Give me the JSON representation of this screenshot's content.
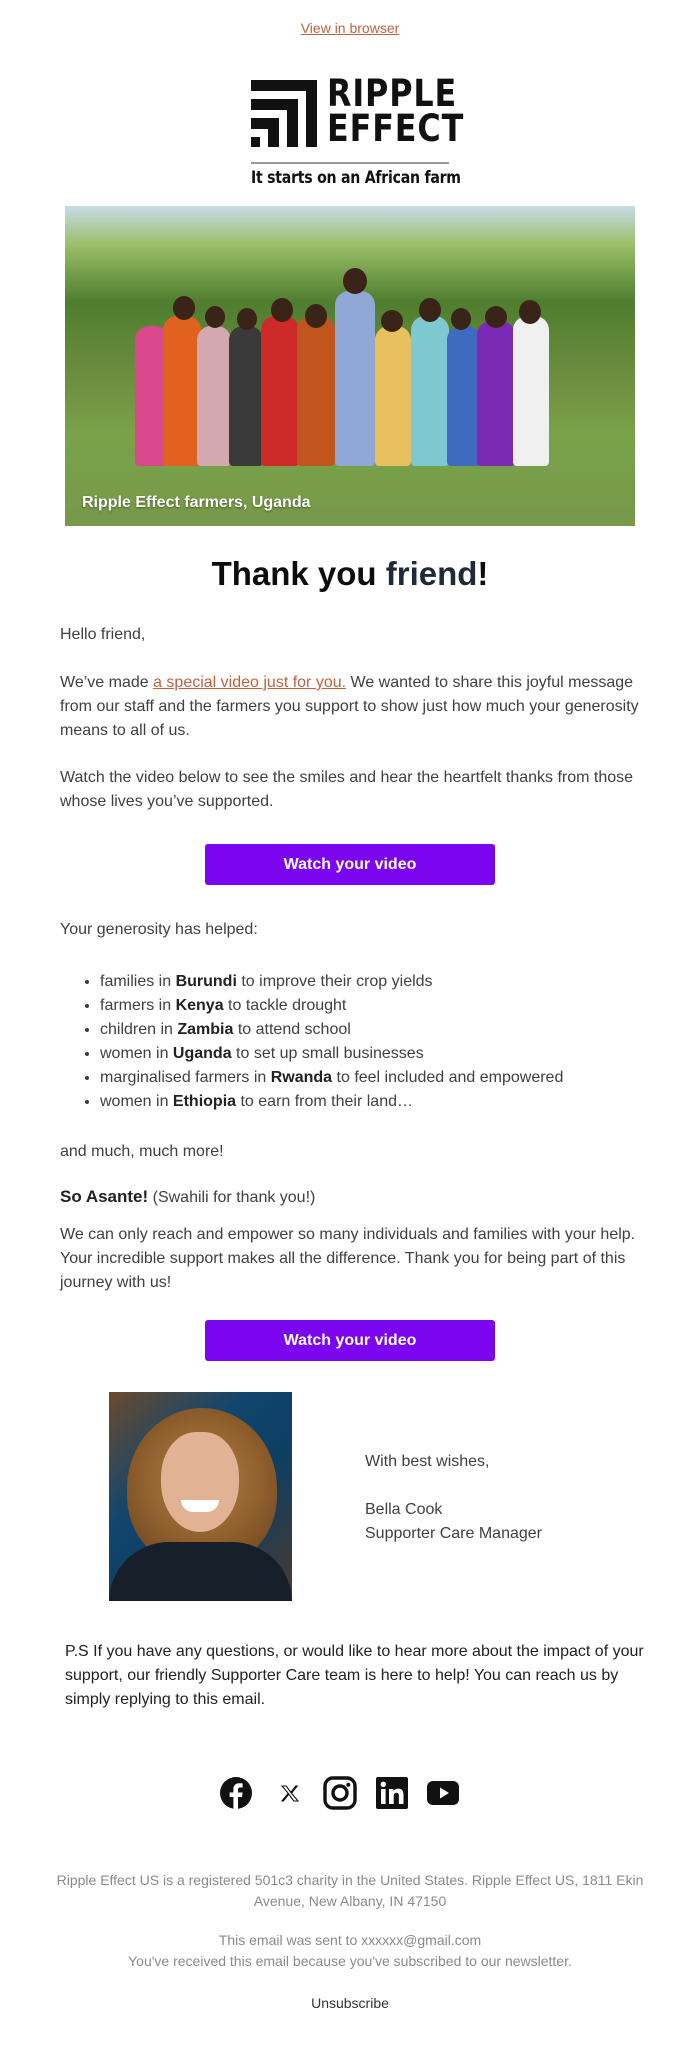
{
  "header": {
    "view_in_browser": "View in browser"
  },
  "logo": {
    "line1": "RIPPLE",
    "line2": "EFFECT",
    "tagline": "It starts on an African farm"
  },
  "hero": {
    "caption": "Ripple Effect farmers, Uganda"
  },
  "title": {
    "prefix": "Thank you ",
    "name": "friend",
    "suffix": "!"
  },
  "body": {
    "greeting": "Hello friend,",
    "p1_before": "We’ve made ",
    "p1_link": "a special video just for you.",
    "p1_after": " We wanted to share this joyful message from our staff and the farmers you support to show just how much your generosity means to all of us.",
    "p2": "Watch the video below to see the smiles and hear the heartfelt thanks from those whose lives you’ve supported.",
    "helped_intro": "Your generosity has helped:",
    "helped": [
      {
        "before": "families in ",
        "country": "Burundi",
        "after": " to improve their crop yields"
      },
      {
        "before": "farmers in ",
        "country": "Kenya",
        "after": " to tackle drought"
      },
      {
        "before": "children in ",
        "country": "Zambia",
        "after": " to attend school"
      },
      {
        "before": "women in ",
        "country": "Uganda",
        "after": " to set up small businesses"
      },
      {
        "before": "marginalised farmers in ",
        "country": "Rwanda",
        "after": " to feel included and empowered"
      },
      {
        "before": "women in ",
        "country": "Ethiopia",
        "after": " to earn from their land…"
      }
    ],
    "more": "and much, much more!",
    "asante_bold": "So Asante!",
    "asante_note": " (Swahili for thank you!)",
    "p3": "We can only reach and empower so many individuals and families with your help. Your incredible support makes all the difference. Thank you for being part of this journey with us!"
  },
  "buttons": {
    "watch_video_1": "Watch your video",
    "watch_video_2": "Watch your video"
  },
  "signature": {
    "closing": "With best wishes,",
    "name": "Bella Cook",
    "role": "Supporter Care Manager"
  },
  "ps": "P.S If you have any questions, or would like to hear more about the impact of your support, our friendly Supporter Care team is here to help! You can reach us by simply replying to this email.",
  "social": [
    {
      "name": "facebook-icon",
      "label": "Facebook"
    },
    {
      "name": "x-icon",
      "label": "X"
    },
    {
      "name": "instagram-icon",
      "label": "Instagram"
    },
    {
      "name": "linkedin-icon",
      "label": "LinkedIn"
    },
    {
      "name": "youtube-icon",
      "label": "YouTube"
    }
  ],
  "footer": {
    "legal": "Ripple Effect US is a registered 501c3 charity in the United States. Ripple Effect US, 1811 Ekin Avenue, New Albany, IN 47150",
    "sent_to": "This email was sent to xxxxxx@gmail.com",
    "reason": "You've received this email because you've subscribed to our newsletter.",
    "unsubscribe": "Unsubscribe"
  },
  "colors": {
    "link": "#c0623f",
    "button": "#7b05ef",
    "title_name": "#1e2a3a",
    "body_text": "#404040",
    "footer_text": "#8a8a8a"
  }
}
